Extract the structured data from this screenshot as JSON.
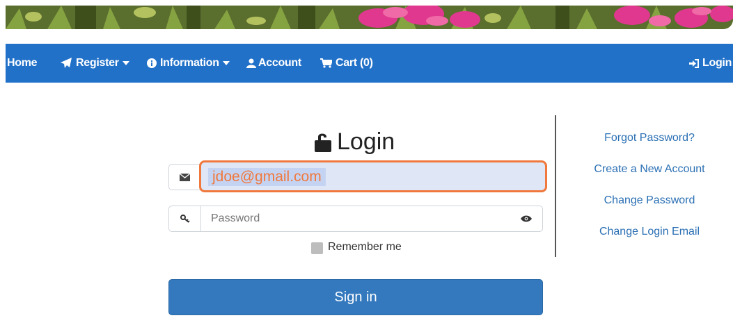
{
  "nav": {
    "home": "Home",
    "register": "Register",
    "information": "Information",
    "account": "Account",
    "cart": "Cart (0)",
    "login": "Login"
  },
  "login": {
    "title": "Login",
    "email_value": "jdoe@gmail.com",
    "password_placeholder": "Password",
    "remember_label": "Remember me",
    "signin_label": "Sign in"
  },
  "side_links": {
    "forgot": "Forgot Password?",
    "create": "Create a New Account",
    "change_password": "Change Password",
    "change_email": "Change Login Email"
  },
  "icons": {
    "register": "paper-plane-icon",
    "information": "info-circle-icon",
    "account": "user-icon",
    "cart": "cart-icon",
    "login": "sign-in-icon",
    "title": "unlock-icon",
    "email": "envelope-icon",
    "password": "key-icon",
    "show_password": "eye-icon"
  },
  "colors": {
    "nav": "#2271c9",
    "highlight": "#f0783c",
    "button": "#3479bd",
    "link": "#2a6fb3"
  }
}
